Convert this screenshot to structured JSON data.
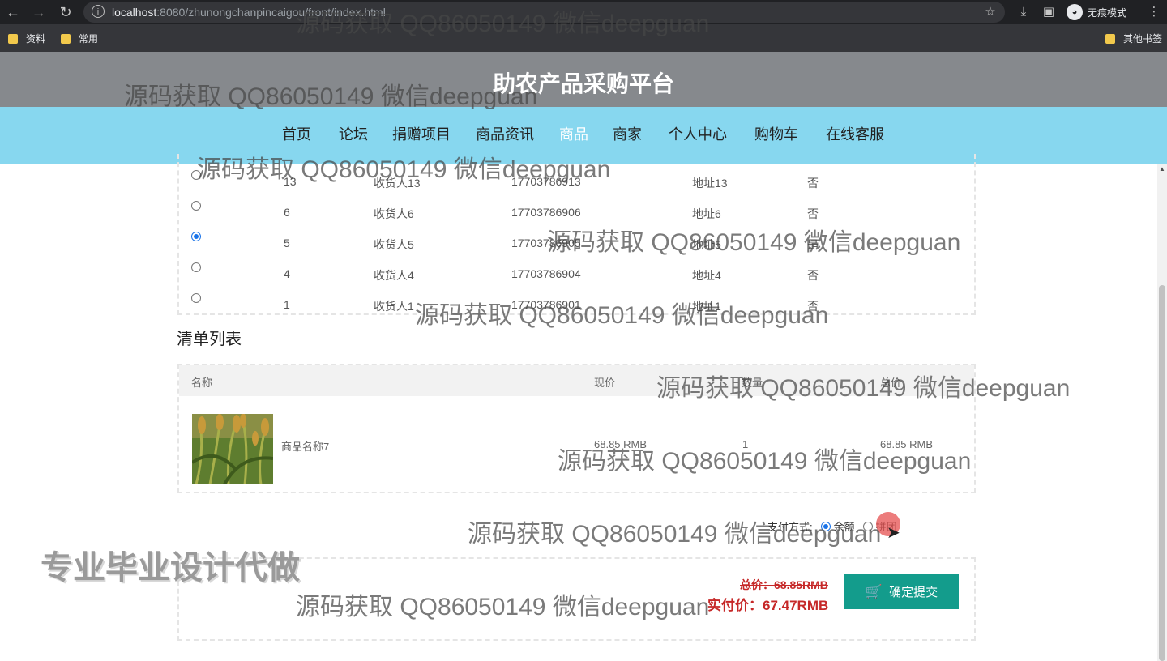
{
  "browser": {
    "url_host": "localhost",
    "url_path": ":8080/zhunongchanpincaigou/front/index.html",
    "incognito_label": "无痕模式",
    "bookmarks": [
      "资料",
      "常用"
    ],
    "other_bookmarks": "其他书签"
  },
  "site": {
    "title": "助农产品采购平台",
    "nav": [
      "首页",
      "论坛",
      "捐赠项目",
      "商品资讯",
      "商品",
      "商家",
      "个人中心",
      "购物车",
      "在线客服"
    ],
    "active_nav": "商品"
  },
  "addresses": [
    {
      "id": "13",
      "name": "收货人13",
      "phone": "17703786913",
      "address": "地址13",
      "default": "否",
      "selected": false
    },
    {
      "id": "6",
      "name": "收货人6",
      "phone": "17703786906",
      "address": "地址6",
      "default": "否",
      "selected": false
    },
    {
      "id": "5",
      "name": "收货人5",
      "phone": "17703786905",
      "address": "地址5",
      "default": "是",
      "selected": true
    },
    {
      "id": "4",
      "name": "收货人4",
      "phone": "17703786904",
      "address": "地址4",
      "default": "否",
      "selected": false
    },
    {
      "id": "1",
      "name": "收货人1",
      "phone": "17703786901",
      "address": "地址1",
      "default": "否",
      "selected": false
    }
  ],
  "cart": {
    "section_title": "清单列表",
    "headers": {
      "name": "名称",
      "price": "现价",
      "qty": "数量",
      "total": "总价"
    },
    "items": [
      {
        "name": "商品名称7",
        "price": "68.85 RMB",
        "qty": "1",
        "total": "68.85 RMB"
      }
    ]
  },
  "payment": {
    "label": "支付方式:",
    "options": [
      "余额",
      "拼团"
    ],
    "selected": "余额"
  },
  "summary": {
    "total": "总价：68.85RMB",
    "actual": "实付价：67.47RMB",
    "submit_label": "确定提交"
  },
  "watermark": "源码获取 QQ86050149 微信deepguan",
  "stamp": "专业毕业设计代做",
  "icons": {
    "back": "back-arrow-icon",
    "forward": "forward-arrow-icon",
    "reload": "reload-icon",
    "info": "info-icon",
    "star": "bookmark-star-icon",
    "download": "download-icon",
    "sidebar": "sidebar-icon",
    "menu": "menu-dots-icon",
    "cart": "cart-icon"
  }
}
